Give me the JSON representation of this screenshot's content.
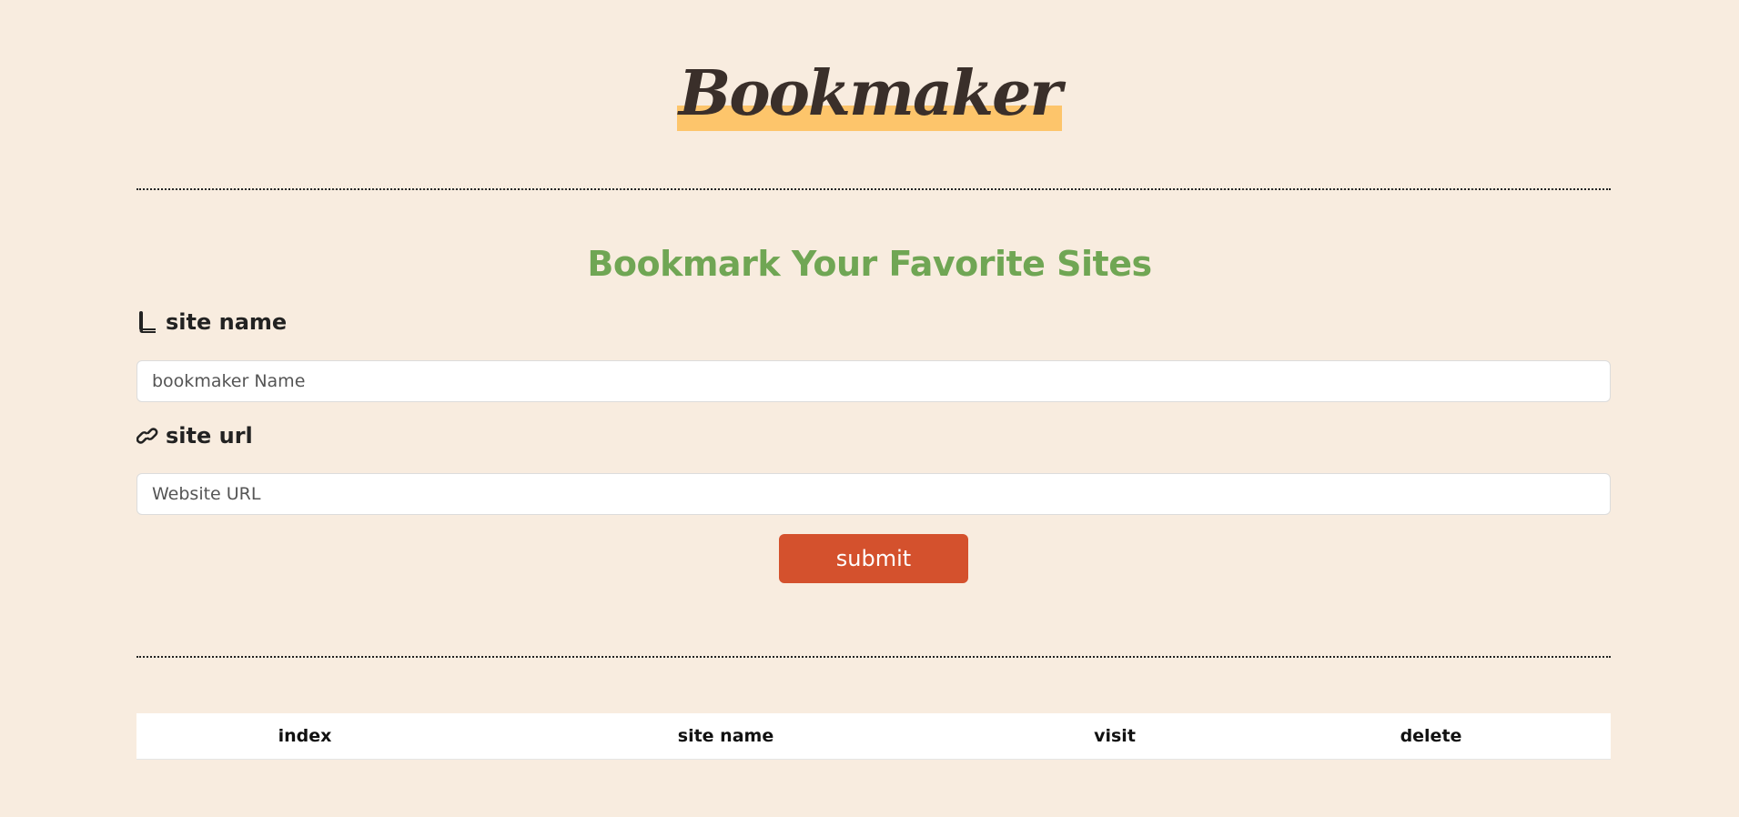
{
  "header": {
    "logo_text": "Bookmaker"
  },
  "form": {
    "heading": "Bookmark Your Favorite Sites",
    "site_name_label": "site name",
    "site_name_placeholder": "bookmaker Name",
    "site_name_icon": "book-icon",
    "site_url_label": "site url",
    "site_url_placeholder": "Website URL",
    "site_url_icon": "link-icon",
    "submit_label": "submit"
  },
  "table": {
    "columns": [
      "index",
      "site name",
      "visit",
      "delete"
    ]
  },
  "colors": {
    "background": "#f8ecdf",
    "logo_highlight": "#fdc56b",
    "heading": "#70a654",
    "submit_button": "#d4512d"
  }
}
